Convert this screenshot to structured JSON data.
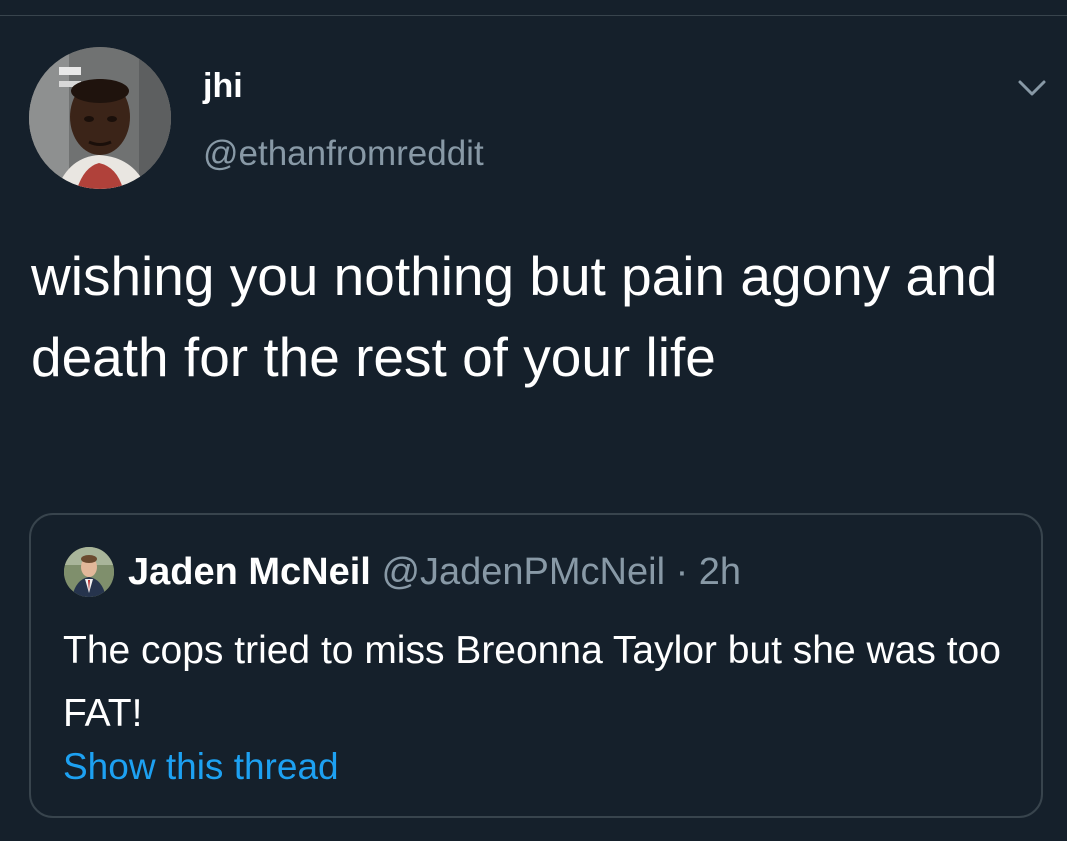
{
  "tweet": {
    "author": {
      "display_name": "jhi",
      "handle": "@ethanfromreddit"
    },
    "menu_icon": "chevron-down-icon",
    "text": "wishing you nothing but pain agony and death for the rest of your life"
  },
  "quoted_tweet": {
    "author": {
      "display_name": "Jaden McNeil",
      "handle": "@JadenPMcNeil"
    },
    "separator": "·",
    "time": "2h",
    "text": "The cops tried to miss Breonna Taylor but she was too FAT!",
    "show_thread_label": "Show this thread"
  },
  "colors": {
    "background": "#15202b",
    "border": "#38444d",
    "secondary_text": "#8899a6",
    "link": "#1da1f2",
    "primary_text": "#ffffff"
  }
}
